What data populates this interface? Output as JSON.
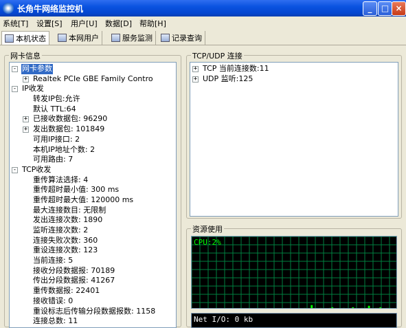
{
  "window": {
    "title": "长角牛网络监控机"
  },
  "menu": [
    {
      "label": "系统[T]"
    },
    {
      "label": "设置[S]"
    },
    {
      "label": "用户[U]"
    },
    {
      "label": "数据[D]"
    },
    {
      "label": "帮助[H]"
    }
  ],
  "tabs": [
    {
      "label": "本机状态"
    },
    {
      "label": "本网用户"
    },
    {
      "label": "服务监测"
    },
    {
      "label": "记录查询"
    }
  ],
  "left_group": {
    "title": "网卡信息",
    "tree": [
      {
        "text": "网卡参数",
        "level": 0,
        "expander": "-",
        "selected": true
      },
      {
        "text": "Realtek PCIe GBE Family Contro",
        "level": 1,
        "expander": "+"
      },
      {
        "text": "IP收发",
        "level": 0,
        "expander": "-"
      },
      {
        "text": "转发IP包:允许",
        "level": 1
      },
      {
        "text": "默认 TTL:64",
        "level": 1
      },
      {
        "text": "已接收数据包: 96290",
        "level": 1,
        "expander": "+"
      },
      {
        "text": "发出数据包: 101849",
        "level": 1,
        "expander": "+"
      },
      {
        "text": "可用IP接口: 2",
        "level": 1
      },
      {
        "text": "本机IP地址个数: 2",
        "level": 1
      },
      {
        "text": "可用路由: 7",
        "level": 1
      },
      {
        "text": "TCP收发",
        "level": 0,
        "expander": "-"
      },
      {
        "text": "重传算法选择: 4",
        "level": 1
      },
      {
        "text": "重传超时最小值: 300 ms",
        "level": 1
      },
      {
        "text": "重传超时最大值: 120000 ms",
        "level": 1
      },
      {
        "text": "最大连接数目: 无限制",
        "level": 1
      },
      {
        "text": "发出连接次数: 1890",
        "level": 1
      },
      {
        "text": "监听连接次数: 2",
        "level": 1
      },
      {
        "text": "连接失败次数: 360",
        "level": 1
      },
      {
        "text": "重设连接次数: 123",
        "level": 1
      },
      {
        "text": "当前连接: 5",
        "level": 1
      },
      {
        "text": "接收分段数据报: 70189",
        "level": 1
      },
      {
        "text": "传出分段数据报: 41267",
        "level": 1
      },
      {
        "text": "重传数据报: 22401",
        "level": 1
      },
      {
        "text": "接收错误: 0",
        "level": 1
      },
      {
        "text": "重设标志后传输分段数据报数: 1158",
        "level": 1
      },
      {
        "text": "连接总数: 11",
        "level": 1
      }
    ]
  },
  "right_top": {
    "title": "TCP/UDP 连接",
    "tree": [
      {
        "text": "TCP 当前连接数:11",
        "expander": "+"
      },
      {
        "text": "UDP 监听:125",
        "expander": "+"
      }
    ]
  },
  "resource": {
    "title": "资源使用",
    "cpu_label": "CPU:2%",
    "net_label": "Net I/O: 0 kb",
    "cpu_history": [
      0,
      0,
      0,
      0,
      0,
      0,
      0,
      0,
      0,
      0,
      0,
      0,
      0,
      0,
      0,
      0,
      0,
      0,
      0,
      0,
      0,
      0,
      0,
      0,
      0,
      0,
      0,
      0,
      0,
      0,
      1,
      0,
      0,
      0,
      0,
      1,
      0,
      0,
      1,
      0,
      0,
      0,
      1,
      0,
      0,
      0,
      1,
      0,
      0,
      2,
      0,
      0,
      6,
      0,
      0,
      0,
      2,
      1,
      0,
      0,
      2,
      3,
      0,
      0,
      1,
      0,
      2,
      0,
      0,
      1,
      3,
      0,
      0,
      1,
      2,
      0,
      2,
      5,
      0,
      1,
      2,
      2,
      3,
      0,
      0,
      2,
      2,
      1,
      0,
      2
    ]
  }
}
